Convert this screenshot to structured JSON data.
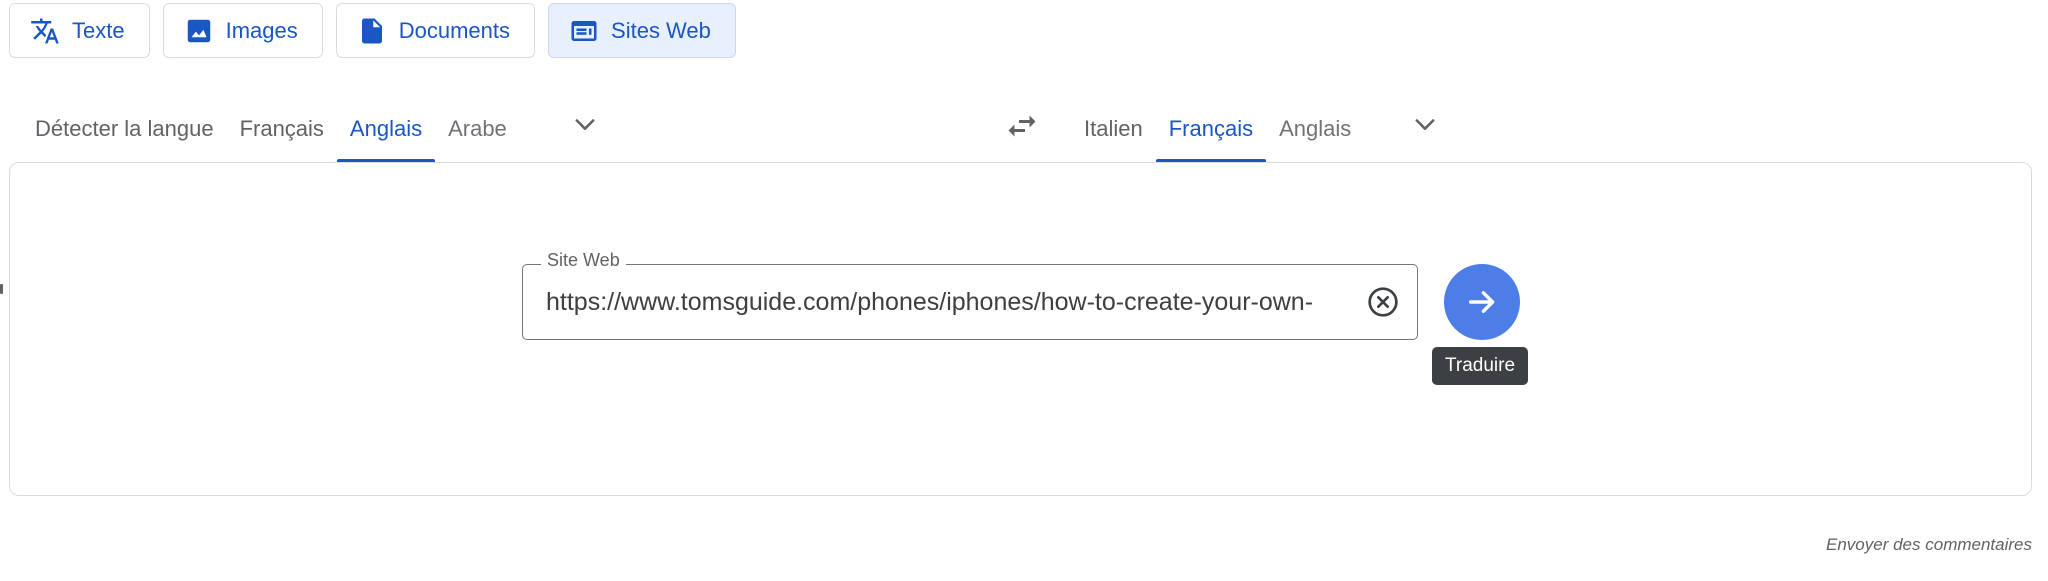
{
  "modes": [
    {
      "label": "Texte",
      "icon": "translate-icon"
    },
    {
      "label": "Images",
      "icon": "image-icon"
    },
    {
      "label": "Documents",
      "icon": "document-icon"
    },
    {
      "label": "Sites Web",
      "icon": "website-icon",
      "active": true
    }
  ],
  "source_languages": {
    "items": [
      "Détecter la langue",
      "Français",
      "Anglais",
      "Arabe"
    ],
    "selected": "Anglais"
  },
  "target_languages": {
    "items": [
      "Italien",
      "Français",
      "Anglais"
    ],
    "selected": "Français"
  },
  "website_field": {
    "label": "Site Web",
    "value": "https://www.tomsguide.com/phones/iphones/how-to-create-your-own-"
  },
  "translate_button": {
    "tooltip": "Traduire"
  },
  "feedback": {
    "label": "Envoyer des commentaires"
  },
  "colors": {
    "accent": "#1a56c4",
    "active_tab_bg": "#e8effd",
    "go_button": "#4d7ee8",
    "tooltip_bg": "#3c4043"
  }
}
